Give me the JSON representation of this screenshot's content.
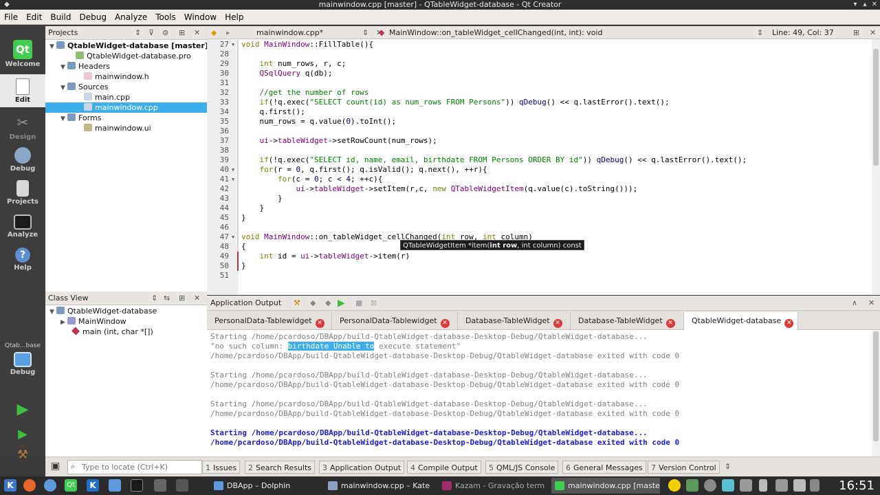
{
  "window": {
    "title": "mainwindow.cpp [master] - QTableWidget-database - Qt Creator"
  },
  "menu": [
    "File",
    "Edit",
    "Build",
    "Debug",
    "Analyze",
    "Tools",
    "Window",
    "Help"
  ],
  "modes": [
    {
      "label": "Welcome",
      "icon": "qt-logo-icon"
    },
    {
      "label": "Edit",
      "icon": "edit-document-icon"
    },
    {
      "label": "Design",
      "icon": "design-tools-icon"
    },
    {
      "label": "Debug",
      "icon": "debug-bug-icon"
    },
    {
      "label": "Projects",
      "icon": "projects-icon"
    },
    {
      "label": "Analyze",
      "icon": "analyze-monitor-icon"
    },
    {
      "label": "Help",
      "icon": "help-icon"
    }
  ],
  "target": {
    "kit_label": "Qtab...base",
    "build_label": "Debug"
  },
  "projects": {
    "title": "Projects",
    "items": [
      {
        "label": "QtableWidget-database [master]",
        "icon": "project-icon"
      },
      {
        "label": "QtableWidget-database.pro",
        "icon": "pro-file-icon"
      },
      {
        "label": "Headers",
        "icon": "folder-icon"
      },
      {
        "label": "mainwindow.h",
        "icon": "header-file-icon"
      },
      {
        "label": "Sources",
        "icon": "folder-icon"
      },
      {
        "label": "main.cpp",
        "icon": "cpp-file-icon"
      },
      {
        "label": "mainwindow.cpp",
        "icon": "cpp-file-icon"
      },
      {
        "label": "Forms",
        "icon": "folder-icon"
      },
      {
        "label": "mainwindow.ui",
        "icon": "ui-file-icon"
      }
    ]
  },
  "classview": {
    "title": "Class View",
    "items": [
      {
        "label": "QtableWidget-database"
      },
      {
        "label": "MainWindow"
      },
      {
        "label": "main (int, char *[])"
      }
    ]
  },
  "editor": {
    "file": "mainwindow.cpp*",
    "symbol": "MainWindow::on_tableWidget_cellChanged(int, int): void",
    "position": "Line: 49, Col: 37",
    "lines": [
      {
        "n": "27",
        "t": "void MainWindow::FillTable(){"
      },
      {
        "n": "28",
        "t": ""
      },
      {
        "n": "29",
        "t": "    int num_rows, r, c;"
      },
      {
        "n": "30",
        "t": "    QSqlQuery q(db);"
      },
      {
        "n": "31",
        "t": ""
      },
      {
        "n": "32",
        "t": "    //get the number of rows"
      },
      {
        "n": "33",
        "t": "    if(!q.exec(\"SELECT count(id) as num_rows FROM Persons\")) qDebug() << q.lastError().text();"
      },
      {
        "n": "34",
        "t": "    q.first();"
      },
      {
        "n": "35",
        "t": "    num_rows = q.value(0).toInt();"
      },
      {
        "n": "36",
        "t": ""
      },
      {
        "n": "37",
        "t": "    ui->tableWidget->setRowCount(num_rows);"
      },
      {
        "n": "38",
        "t": ""
      },
      {
        "n": "39",
        "t": "    if(!q.exec(\"SELECT id, name, email, birthdate FROM Persons ORDER BY id\")) qDebug() << q.lastError().text();"
      },
      {
        "n": "40",
        "t": "    for(r = 0, q.first(); q.isValid(); q.next(), ++r){"
      },
      {
        "n": "41",
        "t": "        for(c = 0; c < 4; ++c){"
      },
      {
        "n": "42",
        "t": "            ui->tableWidget->setItem(r,c, new QTableWidgetItem(q.value(c).toString()));"
      },
      {
        "n": "43",
        "t": "        }"
      },
      {
        "n": "44",
        "t": "    }"
      },
      {
        "n": "45",
        "t": "}"
      },
      {
        "n": "46",
        "t": ""
      },
      {
        "n": "47",
        "t": "void MainWindow::on_tableWidget_cellChanged(int row, int column)"
      },
      {
        "n": "48",
        "t": "{"
      },
      {
        "n": "49",
        "t": "    int id = ui->tableWidget->item(r)"
      },
      {
        "n": "50",
        "t": "}"
      },
      {
        "n": "51",
        "t": ""
      }
    ],
    "tooltip": {
      "prefix": "QTableWidgetItem *item(",
      "bold": "int row",
      "suffix": ", int column) const"
    }
  },
  "output": {
    "title": "Application Output",
    "tabs": [
      {
        "label": "PersonalData-Tablewidget"
      },
      {
        "label": "PersonalData-Tablewidget"
      },
      {
        "label": "Database-TableWidget"
      },
      {
        "label": "Database-TableWidget"
      },
      {
        "label": "QtableWidget-database"
      }
    ],
    "lines": [
      {
        "t": "Starting /home/pcardoso/DBApp/build-QtableWidget-database-Desktop-Debug/QtableWidget-database...",
        "s": "grey"
      },
      {
        "t": "\"no such column: ",
        "hl": "birthdate Unable to",
        "rest": " execute statement\"",
        "s": "grey"
      },
      {
        "t": "/home/pcardoso/DBApp/build-QtableWidget-database-Desktop-Debug/QtableWidget-database exited with code 0",
        "s": "grey"
      },
      {
        "t": "",
        "s": "grey"
      },
      {
        "t": "Starting /home/pcardoso/DBApp/build-QtableWidget-database-Desktop-Debug/QtableWidget-database...",
        "s": "grey"
      },
      {
        "t": "/home/pcardoso/DBApp/build-QtableWidget-database-Desktop-Debug/QtableWidget-database exited with code 0",
        "s": "grey"
      },
      {
        "t": "",
        "s": "grey"
      },
      {
        "t": "Starting /home/pcardoso/DBApp/build-QtableWidget-database-Desktop-Debug/QtableWidget-database...",
        "s": "grey"
      },
      {
        "t": "/home/pcardoso/DBApp/build-QtableWidget-database-Desktop-Debug/QtableWidget-database exited with code 0",
        "s": "grey"
      },
      {
        "t": "",
        "s": "grey"
      },
      {
        "t": "Starting /home/pcardoso/DBApp/build-QtableWidget-database-Desktop-Debug/QtableWidget-database...",
        "s": "blue"
      },
      {
        "t": "/home/pcardoso/DBApp/build-QtableWidget-database-Desktop-Debug/QtableWidget-database exited with code 0",
        "s": "blue"
      }
    ]
  },
  "locator": {
    "placeholder": "Type to locate (Ctrl+K)"
  },
  "panes": [
    {
      "n": "1",
      "label": "Issues"
    },
    {
      "n": "2",
      "label": "Search Results"
    },
    {
      "n": "3",
      "label": "Application Output"
    },
    {
      "n": "4",
      "label": "Compile Output"
    },
    {
      "n": "5",
      "label": "QML/JS Console"
    },
    {
      "n": "6",
      "label": "General Messages"
    },
    {
      "n": "7",
      "label": "Version Control"
    }
  ],
  "taskbar": {
    "tasks": [
      {
        "label": "DBApp – Dolphin",
        "icon": "dolphin-icon"
      },
      {
        "label": "mainwindow.cpp – Kate",
        "icon": "kate-icon"
      },
      {
        "label": "Kazam - Gravação term",
        "icon": "kazam-icon"
      },
      {
        "label": "mainwindow.cpp [maste",
        "icon": "qtcreator-icon"
      }
    ],
    "clock": "16:51"
  },
  "colors": {
    "accent": "#3daee9",
    "sidebar": "#3d3d3d",
    "close_red": "#d93a3a"
  }
}
